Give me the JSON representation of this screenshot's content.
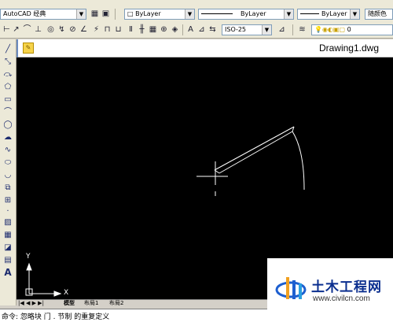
{
  "toolbar": {
    "workspace": "AutoCAD 经典",
    "layer": "ByLayer",
    "linetype": "ByLayer",
    "lineweight": "ByLayer",
    "plotstyle": "随颜色",
    "dimstyle": "ISO-25",
    "layer_value": "0"
  },
  "drawing": {
    "title": "Drawing1.dwg",
    "tabs": [
      "模型",
      "布局1",
      "布局2"
    ]
  },
  "ucs": {
    "x_label": "X",
    "y_label": "Y"
  },
  "command_line": {
    "text": "命令: 忽略块 门 . 节制 的重复定义"
  },
  "watermark": {
    "title": "土木工程网",
    "url": "www.civilcn.com"
  }
}
